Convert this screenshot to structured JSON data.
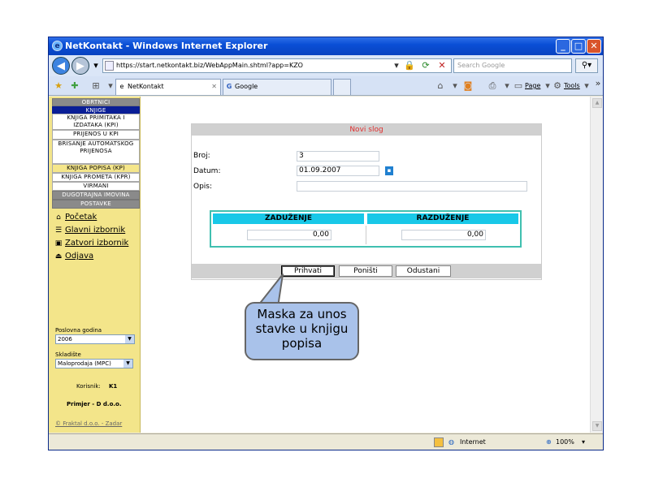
{
  "window": {
    "title": "NetKontakt - Windows Internet Explorer",
    "minimize": "_",
    "maximize": "□",
    "close": "✕"
  },
  "address": {
    "url": "https://start.netkontakt.biz/WebAppMain.shtml?app=KZO",
    "search_placeholder": "Search Google"
  },
  "tabs": [
    {
      "label": "NetKontakt",
      "active": true
    },
    {
      "label": "Google",
      "active": false
    }
  ],
  "toolbar": {
    "page_label": "Page",
    "tools_label": "Tools"
  },
  "sidebar": {
    "items": [
      {
        "label": "OBRTNICI",
        "style": "hdr"
      },
      {
        "label": "KNJIGE",
        "style": "blue"
      },
      {
        "label": "KNJIGA PRIMITAKA I IZDATAKA (KPI)",
        "style": "plain"
      },
      {
        "label": "PRIJENOS U KPI",
        "style": "plain"
      },
      {
        "label": "BRISANJE AUTOMATSKOG PRIJENOSA",
        "style": "plain"
      },
      {
        "label": "KNJIGA POPISA (KP)",
        "style": "yel"
      },
      {
        "label": "KNJIGA PROMETA (KPR)",
        "style": "plain"
      },
      {
        "label": "VIRMANI",
        "style": "plain"
      },
      {
        "label": "DUGOTRAJNA IMOVINA",
        "style": "hdr"
      },
      {
        "label": "POSTAVKE",
        "style": "hdr"
      }
    ],
    "links": [
      "Početak",
      "Glavni izbornik",
      "Zatvori izbornik",
      "Odjava"
    ],
    "year_label": "Poslovna godina",
    "year_value": "2006",
    "warehouse_label": "Skladište",
    "warehouse_value": "Maloprodaja (MPC)",
    "user_label": "Korisnik:",
    "user_value": "K1",
    "company": "Primjer - D d.o.o.",
    "copyright": "© Fraktal d.o.o. - Zadar"
  },
  "form": {
    "title": "Novi slog",
    "broj_label": "Broj:",
    "broj_value": "3",
    "datum_label": "Datum:",
    "datum_value": "01.09.2007",
    "opis_label": "Opis:",
    "opis_value": "",
    "col_zaduzenje": "ZADUŽENJE",
    "col_razduzenje": "RAZDUŽENJE",
    "zaduzenje_value": "0,00",
    "razduzenje_value": "0,00",
    "btn_prihvati": "Prihvati",
    "btn_ponisti": "Poništi",
    "btn_odustani": "Odustani"
  },
  "status": {
    "zone": "Internet",
    "zoom": "100%"
  },
  "callout": {
    "text": "Maska za unos stavke u knjigu popisa"
  }
}
